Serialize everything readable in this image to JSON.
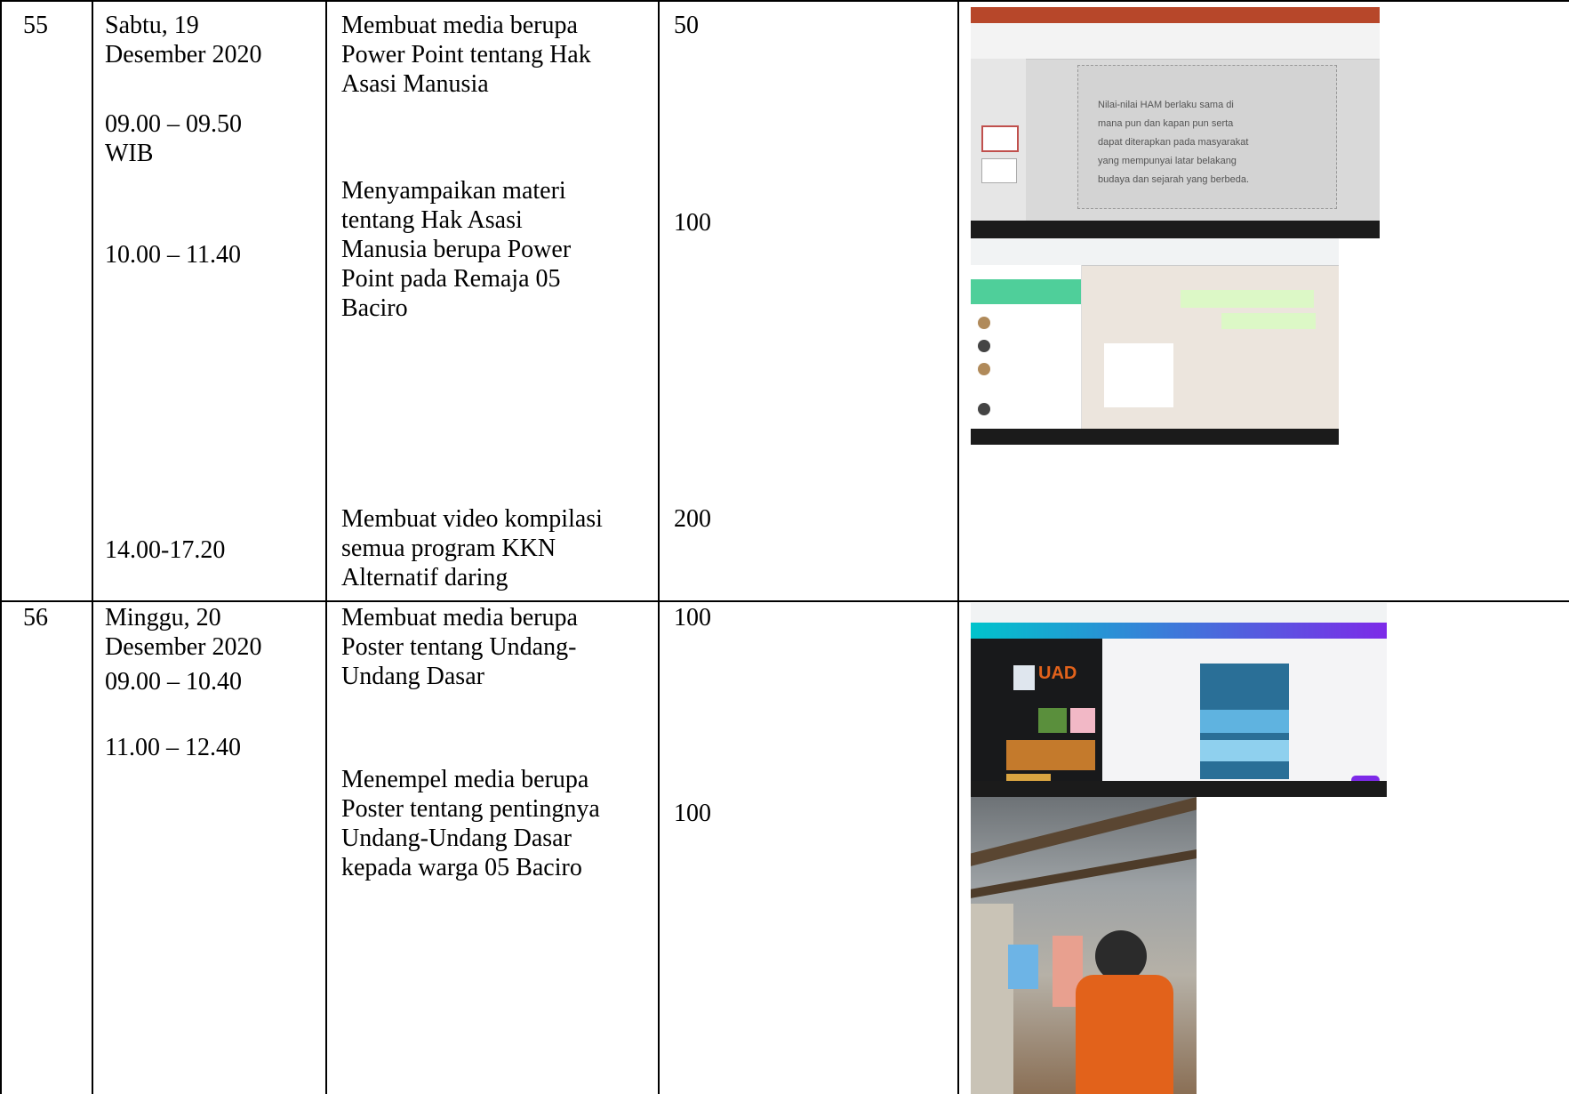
{
  "rows": [
    {
      "no": "55",
      "date": "Sabtu, 19\nDesember 2020",
      "time1": "09.00 – 09.50\nWIB",
      "time2": "10.00 – 11.40",
      "time3": "14.00-17.20",
      "act1": "Membuat media berupa\nPower Point tentang Hak\nAsasi Manusia",
      "act2": "Menyampaikan materi\ntentang Hak Asasi\nManusia berupa Power\nPoint pada Remaja 05\nBaciro",
      "act3": "Membuat video kompilasi\nsemua program KKN\nAlternatif daring",
      "val1": "50",
      "val2": "100",
      "val3": "200",
      "evidence": {
        "ppt_slide_text": "Nilai-nilai HAM berlaku sama di\nmana pun dan kapan pun serta\ndapat diterapkan pada masyarakat\nyang mempunyai latar belakang\nbudaya dan sejarah yang berbeda."
      }
    },
    {
      "no": "56",
      "date": "Minggu, 20\nDesember 2020",
      "time1": "09.00 – 10.40",
      "time2": "11.00 – 12.40",
      "act1": "Membuat media berupa\nPoster tentang Undang-\nUndang Dasar",
      "act2": "Menempel media berupa\nPoster tentang pentingnya\nUndang-Undang Dasar\nkepada warga 05 Baciro",
      "val1": "100",
      "val2": "100",
      "evidence": {
        "canva_logo": "UAD"
      }
    }
  ],
  "colors": {
    "ppt_red": "#b7472a",
    "whatsapp_green": "#25d366",
    "canva_purple": "#7d2ae8",
    "poster_blue": "#1f6fa8",
    "jacket_orange": "#e2621b"
  }
}
